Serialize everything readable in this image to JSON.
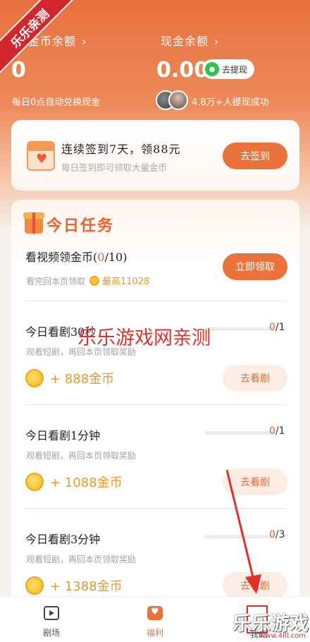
{
  "ribbon": "乐乐亲测",
  "header": {
    "coin_label": "金币余额",
    "coin_value": "0",
    "cash_label": "现金余额",
    "cash_value": "0.00",
    "withdraw_button": "去提现",
    "daily_note": "每日0点自动兑换现金",
    "success_note": "4.8万+人提现成功",
    "chevron": "›"
  },
  "signin": {
    "title": "连续签到7天，领88元",
    "subtitle": "每日签到即可领取大量金币",
    "button": "去签到"
  },
  "tasks": {
    "heading": "今日任务",
    "video": {
      "name_prefix": "看视频领金币(",
      "progress_done": "0",
      "progress_total": "/10)",
      "desc": "看完回本页领取",
      "max_reward": "最高11028",
      "button": "立即领取"
    },
    "items": [
      {
        "name": "今日看剧30秒",
        "desc": "观看短剧，再回本页领取奖励",
        "progress_done": "0",
        "progress_total": "/1",
        "progress": 0,
        "reward": "+ 888金币",
        "button": "去看剧"
      },
      {
        "name": "今日看剧1分钟",
        "desc": "观看短剧，再回本页领取奖励",
        "progress_done": "0",
        "progress_total": "/1",
        "progress": 0,
        "reward": "+ 1088金币",
        "button": "去看剧"
      },
      {
        "name": "今日看剧3分钟",
        "desc": "观看短剧，再回本页领取奖励",
        "progress_done": "0",
        "progress_total": "/3",
        "progress": 0,
        "reward": "+ 1388金币",
        "button": "去看剧"
      }
    ]
  },
  "watermark": "乐乐游戏网亲测",
  "tabbar": {
    "tabs": [
      {
        "label": "剧场"
      },
      {
        "label": "福利"
      },
      {
        "label": "我的"
      }
    ]
  },
  "corner_logo": "乐乐游戏",
  "corner_url": "www.4lll.com"
}
